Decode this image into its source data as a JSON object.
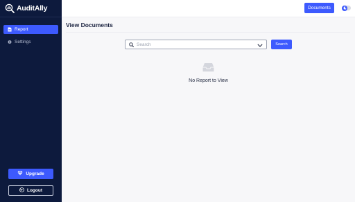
{
  "brand": {
    "name": "AuditAlly"
  },
  "sidebar": {
    "items": [
      {
        "label": "Report",
        "icon": "document-icon",
        "active": true
      },
      {
        "label": "Settings",
        "icon": "gear-icon",
        "active": false
      }
    ],
    "upgrade_label": "Upgrade",
    "logout_label": "Logout"
  },
  "topbar": {
    "documents_label": "Documents",
    "toggle_icon": "moon-icon"
  },
  "main": {
    "title": "View Documents",
    "search": {
      "placeholder": "Search",
      "button_label": "Search"
    },
    "empty_state": {
      "icon": "inbox-icon",
      "message": "No Report to View"
    }
  },
  "colors": {
    "sidebar_bg": "#0d1a3d",
    "accent": "#3d5afe",
    "page_bg": "#f7f7f9"
  }
}
